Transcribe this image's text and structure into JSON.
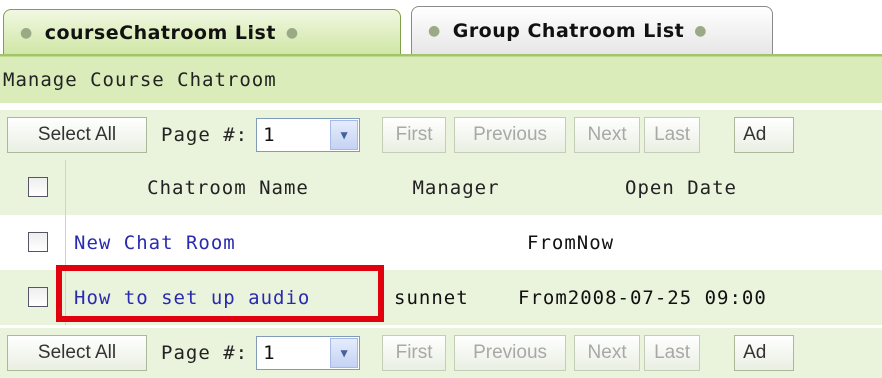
{
  "tabs": [
    {
      "label": "courseChatroom List",
      "active": true
    },
    {
      "label": "Group Chatroom List",
      "active": false
    }
  ],
  "manage_title": "Manage Course Chatroom",
  "toolbar": {
    "select_all": "Select All",
    "page_label": "Page #:",
    "page_value": "1",
    "first": "First",
    "previous": "Previous",
    "next": "Next",
    "last": "Last",
    "add": "Ad"
  },
  "table": {
    "columns": [
      "Chatroom Name",
      "Manager",
      "Open Date"
    ],
    "rows": [
      {
        "name": "New Chat Room",
        "manager": "",
        "open_date": "FromNow"
      },
      {
        "name": "How to set up audio",
        "manager": "sunnet",
        "open_date": "From2008-07-25 09:00"
      }
    ]
  },
  "colors": {
    "accent_green": "#d9ecb9",
    "row_alt": "#eaf3dc",
    "link": "#2a2ab0",
    "highlight": "#e0000e"
  }
}
